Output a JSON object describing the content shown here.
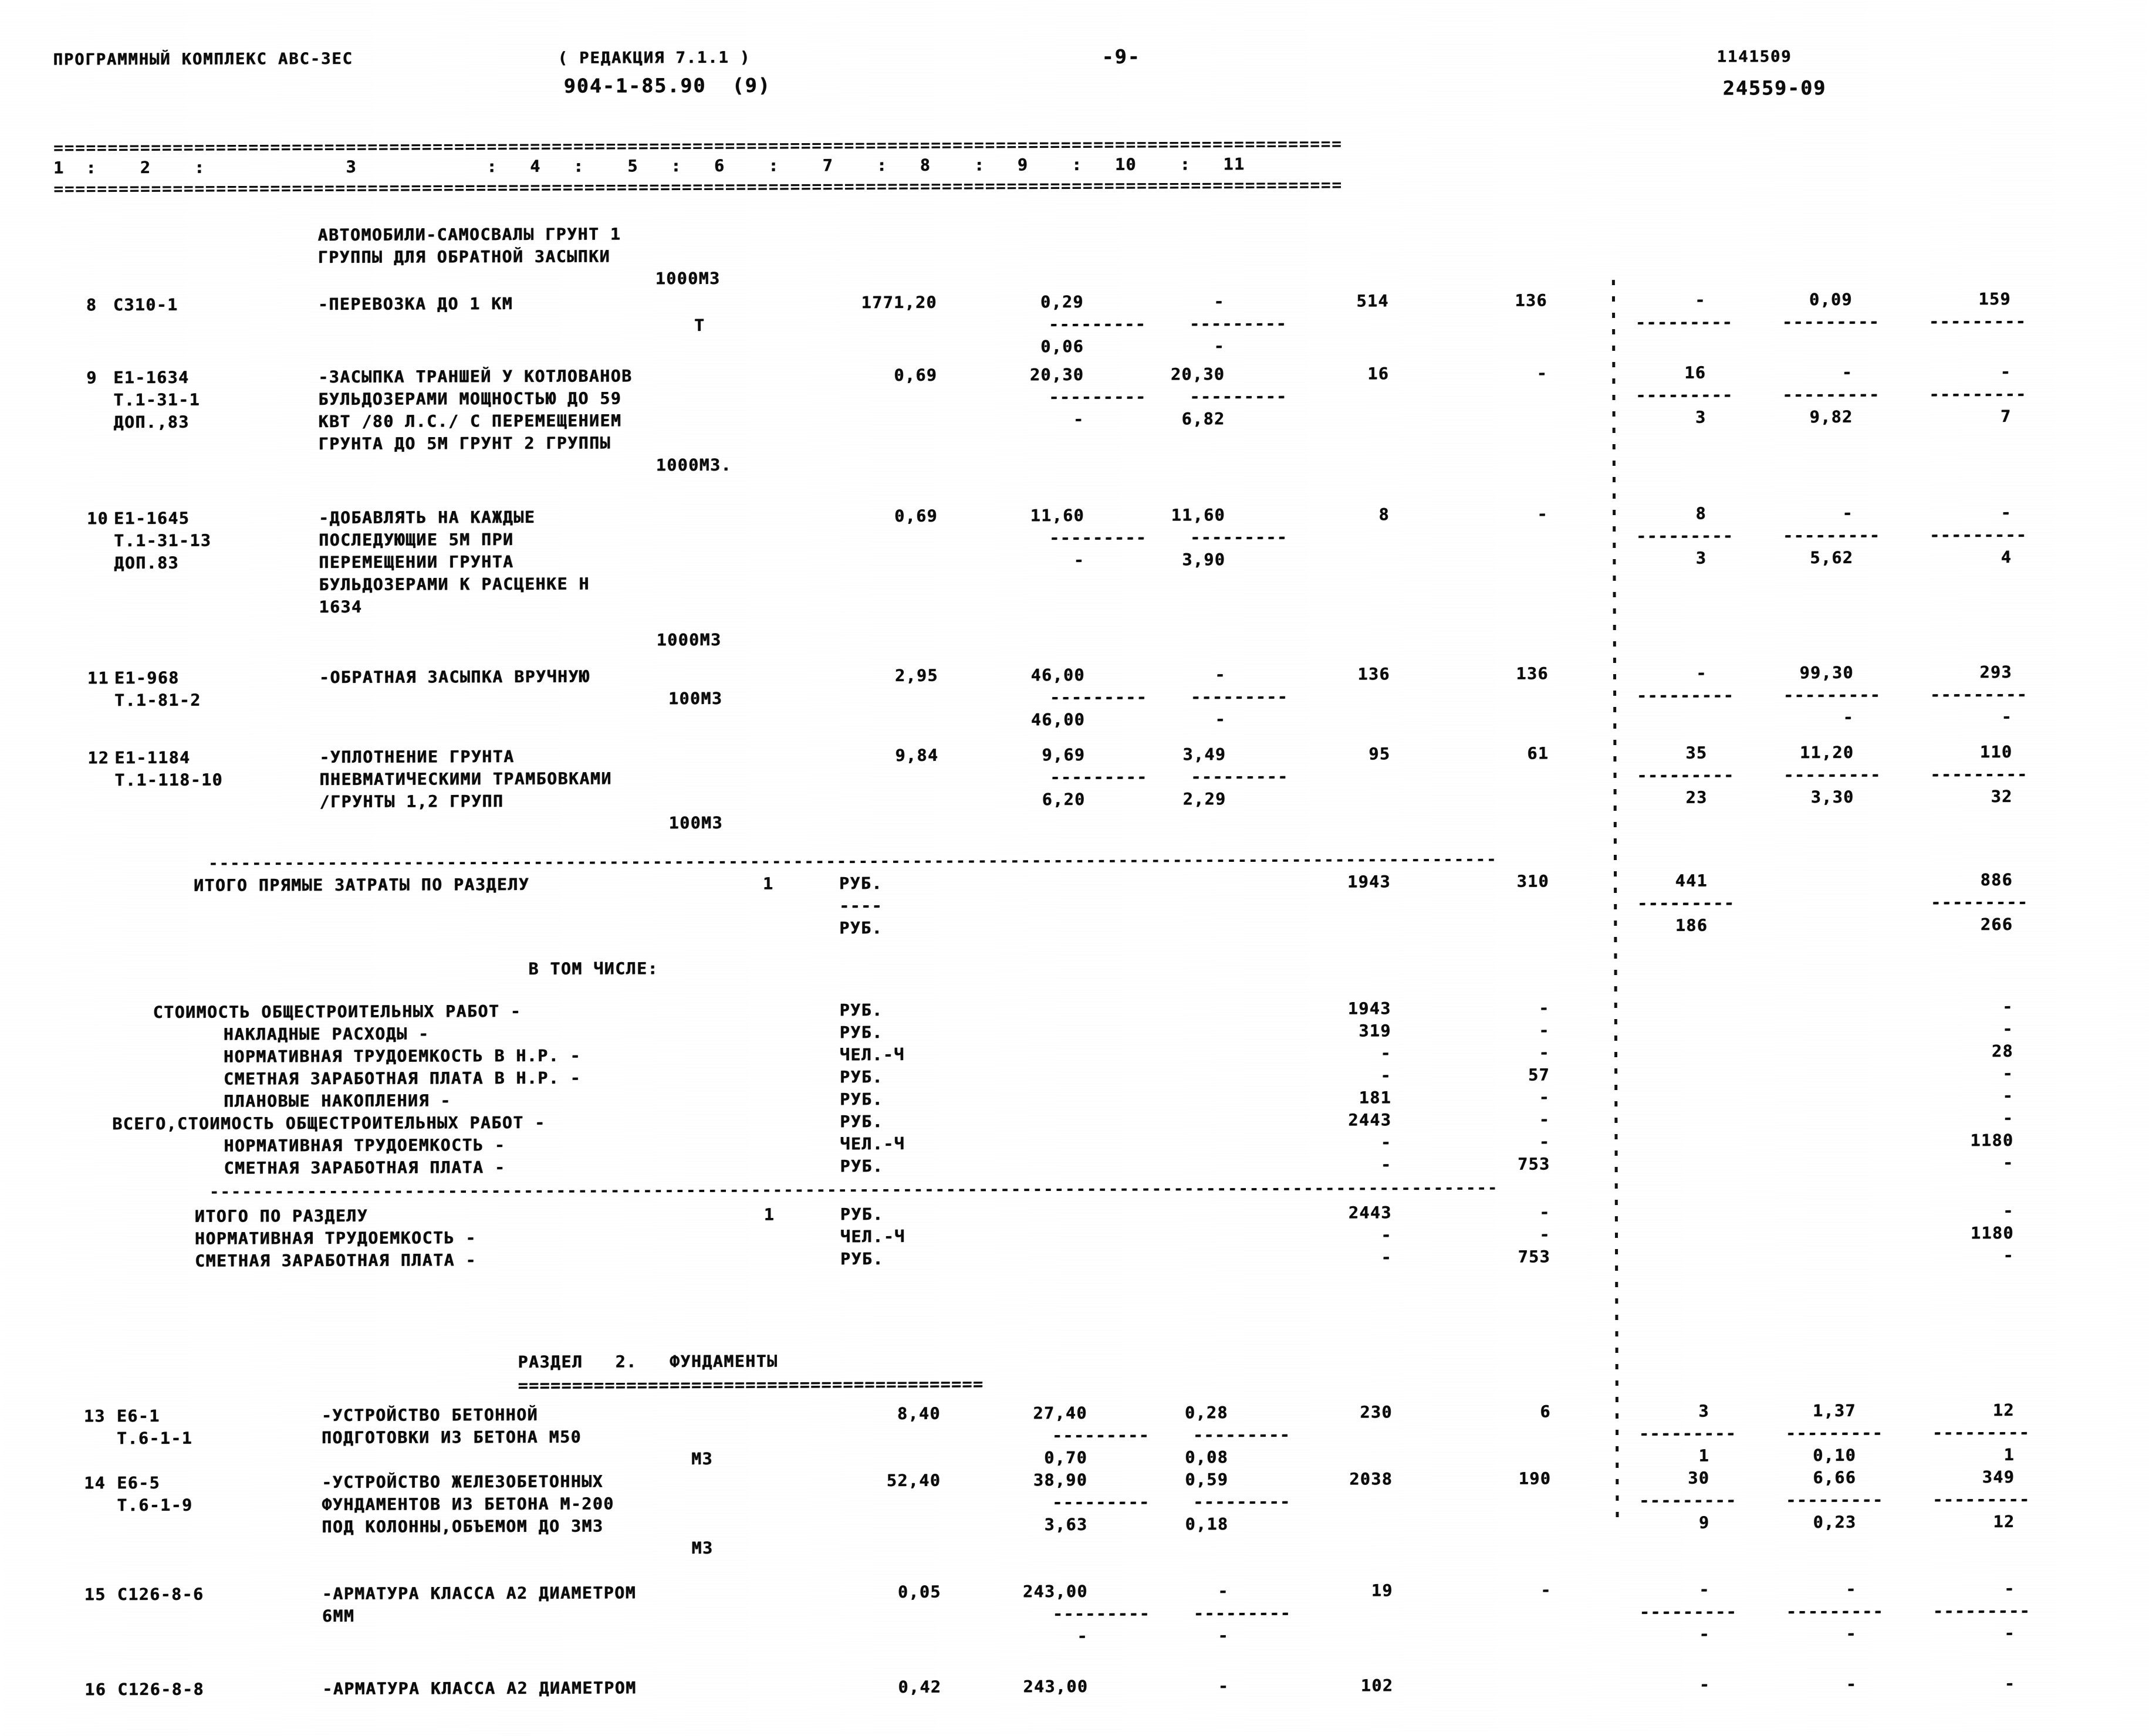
{
  "header": {
    "program_title": "ПРОГРАММНЫЙ КОМПЛЕКС АВС-ЗЕС",
    "edition": "( РЕДАКЦИЯ 7.1.1 )",
    "object_code": "904-1-85.90  (9)",
    "page_number": "-9-",
    "doc_number_top": "1141509",
    "doc_number_bottom": "24559-09"
  },
  "table": {
    "column_header": "1  :    2    :             3            :   4   :    5   :   6    :    7    :   8    :   9    :   10    :   11",
    "separator_top": "=======================================================================================================================",
    "separator_section": "-----------------------------------------------------------------------------------------------------------------------",
    "dash_group": "---------",
    "dash_group_short": "----",
    "section2_rule": "==========================================="
  },
  "rows": [
    {
      "intro": [
        "АВТОМОБИЛИ-САМОСВАЛЫ ГРУНТ 1",
        "ГРУППЫ ДЛЯ ОБРАТНОЙ ЗАСЫПКИ",
        "1000М3"
      ],
      "no": "8",
      "code": "С310-1",
      "desc": [
        "-ПЕРЕВОЗКА ДО 1 КМ"
      ],
      "unit": "Т",
      "c4": "1771,20",
      "c5": "0,29",
      "c6": "-",
      "c7": "514",
      "c8": "136",
      "c9": "-",
      "c10": "0,09",
      "c11": "159",
      "sub": {
        "c5": "0,06",
        "c6": "-",
        "c9": "",
        "c10": "",
        "c11": ""
      }
    },
    {
      "no": "9",
      "code": "Е1-1634",
      "code2": "Т.1-31-1",
      "code3": "ДОП.,83",
      "desc": [
        "-ЗАСЫПКА ТРАНШЕЙ У КОТЛОВАНОВ",
        "БУЛЬДОЗЕРАМИ МОЩНОСТЬЮ ДО 59",
        "КВТ /80 Л.С./ С ПЕРЕМЕЩЕНИЕМ",
        "ГРУНТА ДО 5М ГРУНТ 2 ГРУППЫ",
        "1000М3."
      ],
      "c4": "0,69",
      "c5": "20,30",
      "c6": "20,30",
      "c7": "16",
      "c8": "-",
      "c9": "16",
      "c10": "-",
      "c11": "-",
      "sub": {
        "c5": "-",
        "c6": "6,82",
        "c9": "3",
        "c10": "9,82",
        "c11": "7"
      }
    },
    {
      "no": "10",
      "code": "Е1-1645",
      "code2": "Т.1-31-13",
      "code3": "ДОП.83",
      "desc": [
        "-ДОБАВЛЯТЬ НА КАЖДЫЕ",
        "ПОСЛЕДУЮЩИЕ 5М ПРИ",
        "ПЕРЕМЕЩЕНИИ ГРУНТА",
        "БУЛЬДОЗЕРАМИ К РАСЦЕНКЕ Н",
        "1634",
        "1000М3"
      ],
      "c4": "0,69",
      "c5": "11,60",
      "c6": "11,60",
      "c7": "8",
      "c8": "-",
      "c9": "8",
      "c10": "-",
      "c11": "-",
      "sub": {
        "c5": "-",
        "c6": "3,90",
        "c9": "3",
        "c10": "5,62",
        "c11": "4"
      }
    },
    {
      "no": "11",
      "code": "Е1-968",
      "code2": "Т.1-81-2",
      "desc": [
        "-ОБРАТНАЯ ЗАСЫПКА ВРУЧНУЮ",
        "100М3"
      ],
      "c4": "2,95",
      "c5": "46,00",
      "c6": "-",
      "c7": "136",
      "c8": "136",
      "c9": "-",
      "c10": "99,30",
      "c11": "293",
      "sub": {
        "c5": "46,00",
        "c6": "-",
        "c9": "",
        "c10": "-",
        "c11": "-"
      }
    },
    {
      "no": "12",
      "code": "Е1-1184",
      "code2": "Т.1-118-10",
      "desc": [
        "-УПЛОТНЕНИЕ ГРУНТА",
        "ПНЕВМАТИЧЕСКИМИ ТРАМБОВКАМИ",
        "/ГРУНТЫ 1,2 ГРУПП",
        "100М3"
      ],
      "c4": "9,84",
      "c5": "9,69",
      "c6": "3,49",
      "c7": "95",
      "c8": "61",
      "c9": "35",
      "c10": "11,20",
      "c11": "110",
      "sub": {
        "c5": "6,20",
        "c6": "2,29",
        "c9": "23",
        "c10": "3,30",
        "c11": "32"
      }
    }
  ],
  "totals": {
    "direct_label": "ИТОГО ПРЯМЫЕ ЗАТРАТЫ ПО РАЗДЕЛУ",
    "section_no": "1",
    "unit_rub": "РУБ.",
    "unit_chel": "ЧЕЛ.-Ч",
    "direct_c7": "1943",
    "direct_c8": "310",
    "direct_c9": "441",
    "direct_c11": "886",
    "direct2_c9": "186",
    "direct2_c11": "266",
    "including_label": "В ТОМ ЧИСЛЕ:",
    "lines": [
      {
        "label": "СТОИМОСТЬ ОБЩЕСТРОИТЕЛЬНЫХ РАБОТ -",
        "unit": "РУБ.",
        "c7": "1943",
        "c8": "-",
        "c11": "-",
        "indent": 0
      },
      {
        "label": "НАКЛАДНЫЕ РАСХОДЫ -",
        "unit": "РУБ.",
        "c7": "319",
        "c8": "-",
        "c11": "-",
        "indent": 1
      },
      {
        "label": "НОРМАТИВНАЯ ТРУДОЕМКОСТЬ В Н.Р. -",
        "unit": "ЧЕЛ.-Ч",
        "c7": "-",
        "c8": "-",
        "c11": "28",
        "indent": 1
      },
      {
        "label": "СМЕТНАЯ ЗАРАБОТНАЯ ПЛАТА В Н.Р. -",
        "unit": "РУБ.",
        "c7": "-",
        "c8": "57",
        "c11": "-",
        "indent": 1
      },
      {
        "label": "ПЛАНОВЫЕ НАКОПЛЕНИЯ -",
        "unit": "РУБ.",
        "c7": "181",
        "c8": "-",
        "c11": "-",
        "indent": 1
      },
      {
        "label": "ВСЕГО,СТОИМОСТЬ ОБЩЕСТРОИТЕЛЬНЫХ РАБОТ -",
        "unit": "РУБ.",
        "c7": "2443",
        "c8": "-",
        "c11": "-",
        "indent": 0
      },
      {
        "label": "НОРМАТИВНАЯ ТРУДОЕМКОСТЬ -",
        "unit": "ЧЕЛ.-Ч",
        "c7": "-",
        "c8": "-",
        "c11": "1180",
        "indent": 1
      },
      {
        "label": "СМЕТНАЯ ЗАРАБОТНАЯ ПЛАТА -",
        "unit": "РУБ.",
        "c7": "-",
        "c8": "753",
        "c11": "-",
        "indent": 1
      }
    ],
    "final_lines": [
      {
        "label": "ИТОГО ПО РАЗДЕЛУ",
        "section_no": "1",
        "unit": "РУБ.",
        "c7": "2443",
        "c8": "-",
        "c11": "-",
        "indent": 0
      },
      {
        "label": "НОРМАТИВНАЯ ТРУДОЕМКОСТЬ -",
        "section_no": "",
        "unit": "ЧЕЛ.-Ч",
        "c7": "-",
        "c8": "-",
        "c11": "1180",
        "indent": 0
      },
      {
        "label": "СМЕТНАЯ ЗАРАБОТНАЯ ПЛАТА -",
        "section_no": "",
        "unit": "РУБ.",
        "c7": "-",
        "c8": "753",
        "c11": "-",
        "indent": 0
      }
    ]
  },
  "section2": {
    "title": "РАЗДЕЛ   2.   ФУНДАМЕНТЫ",
    "rows": [
      {
        "no": "13",
        "code": "Е6-1",
        "code2": "Т.6-1-1",
        "desc": [
          "-УСТРОЙСТВО БЕТОННОЙ",
          "ПОДГОТОВКИ ИЗ БЕТОНА М50",
          "М3"
        ],
        "c4": "8,40",
        "c5": "27,40",
        "c6": "0,28",
        "c7": "230",
        "c8": "6",
        "c9": "3",
        "c10": "1,37",
        "c11": "12",
        "sub": {
          "c5": "0,70",
          "c6": "0,08",
          "c9": "1",
          "c10": "0,10",
          "c11": "1"
        }
      },
      {
        "no": "14",
        "code": "Е6-5",
        "code2": "Т.6-1-9",
        "desc": [
          "-УСТРОЙСТВО ЖЕЛЕЗОБЕТОННЫХ",
          "ФУНДАМЕНТОВ ИЗ БЕТОНА М-200",
          "ПОД КОЛОННЫ,ОБЪЕМОМ ДО 3М3",
          "М3"
        ],
        "c4": "52,40",
        "c5": "38,90",
        "c6": "0,59",
        "c7": "2038",
        "c8": "190",
        "c9": "30",
        "c10": "6,66",
        "c11": "349",
        "sub": {
          "c5": "3,63",
          "c6": "0,18",
          "c9": "9",
          "c10": "0,23",
          "c11": "12"
        }
      },
      {
        "no": "15",
        "code": "С126-8-6",
        "desc": [
          "-АРМАТУРА КЛАССА А2 ДИАМЕТРОМ",
          "6ММ"
        ],
        "c4": "0,05",
        "c5": "243,00",
        "c6": "-",
        "c7": "19",
        "c8": "-",
        "c9": "-",
        "c10": "-",
        "c11": "-",
        "sub": {
          "c5": "-",
          "c6": "-",
          "c9": "-",
          "c10": "-",
          "c11": "-"
        }
      },
      {
        "no": "16",
        "code": "С126-8-8",
        "desc": [
          "-АРМАТУРА КЛАССА А2 ДИАМЕТРОМ"
        ],
        "c4": "0,42",
        "c5": "243,00",
        "c6": "-",
        "c7": "102",
        "c8": "",
        "c9": "-",
        "c10": "-",
        "c11": "-"
      }
    ]
  }
}
